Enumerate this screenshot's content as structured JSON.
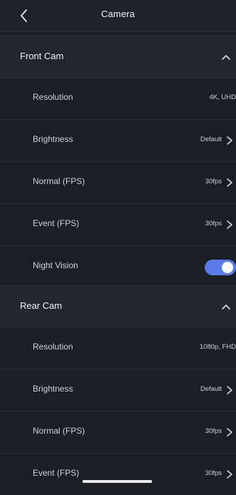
{
  "header": {
    "title": "Camera",
    "back_icon": "chevron-left-icon"
  },
  "front_cam": {
    "title": "Front Cam",
    "collapse_icon": "chevron-up-icon",
    "resolution": {
      "label": "Resolution",
      "value": "4K, UHD"
    },
    "brightness": {
      "label": "Brightness",
      "value": "Default"
    },
    "normal_fps": {
      "label": "Normal (FPS)",
      "value": "30fps"
    },
    "event_fps": {
      "label": "Event (FPS)",
      "value": "30fps"
    },
    "night_vision": {
      "label": "Night Vision",
      "enabled": true
    }
  },
  "rear_cam": {
    "title": "Rear Cam",
    "collapse_icon": "chevron-up-icon",
    "resolution": {
      "label": "Resolution",
      "value": "1080p, FHD"
    },
    "brightness": {
      "label": "Brightness",
      "value": "Default"
    },
    "normal_fps": {
      "label": "Normal (FPS)",
      "value": "30fps"
    },
    "event_fps": {
      "label": "Event (FPS)",
      "value": "30fps"
    }
  },
  "colors": {
    "accent": "#5a7be8",
    "background": "#1b1e24",
    "section": "#23262c"
  }
}
